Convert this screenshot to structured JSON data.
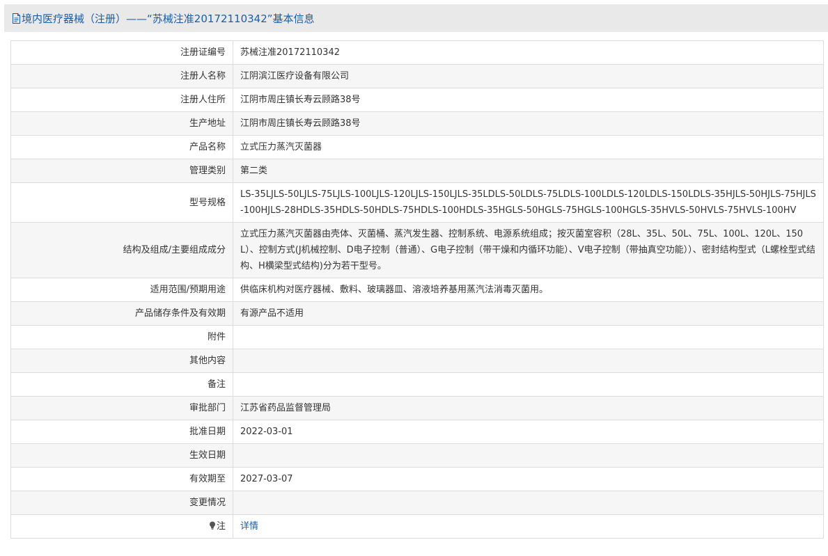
{
  "header": {
    "title": "境内医疗器械（注册）——“苏械注准20172110342”基本信息"
  },
  "rows": [
    {
      "label": "注册证编号",
      "value": "苏械注准20172110342"
    },
    {
      "label": "注册人名称",
      "value": "江阴滨江医疗设备有限公司"
    },
    {
      "label": "注册人住所",
      "value": "江阴市周庄镇长寿云顾路38号"
    },
    {
      "label": "生产地址",
      "value": "江阴市周庄镇长寿云顾路38号"
    },
    {
      "label": "产品名称",
      "value": "立式压力蒸汽灭菌器"
    },
    {
      "label": "管理类别",
      "value": "第二类"
    },
    {
      "label": "型号规格",
      "value": "LS-35LJLS-50LJLS-75LJLS-100LJLS-120LJLS-150LJLS-35LDLS-50LDLS-75LDLS-100LDLS-120LDLS-150LDLS-35HJLS-50HJLS-75HJLS-100HJLS-28HDLS-35HDLS-50HDLS-75HDLS-100HDLS-35HGLS-50HGLS-75HGLS-100HGLS-35HVLS-50HVLS-75HVLS-100HV"
    },
    {
      "label": "结构及组成/主要组成成分",
      "value": "立式压力蒸汽灭菌器由壳体、灭菌桶、蒸汽发生器、控制系统、电源系统组成；按灭菌室容积（28L、35L、50L、75L、100L、120L、150L）、控制方式(J机械控制、D电子控制（普通）、G电子控制（带干燥和内循环功能）、V电子控制（带抽真空功能））、密封结构型式（L螺栓型式结构、H横梁型式结构)分为若干型号。"
    },
    {
      "label": "适用范围/预期用途",
      "value": "供临床机构对医疗器械、敷料、玻璃器皿、溶液培养基用蒸汽法消毒灭菌用。"
    },
    {
      "label": "产品储存条件及有效期",
      "value": "有源产品不适用"
    },
    {
      "label": "附件",
      "value": ""
    },
    {
      "label": "其他内容",
      "value": ""
    },
    {
      "label": "备注",
      "value": ""
    },
    {
      "label": "审批部门",
      "value": "江苏省药品监督管理局"
    },
    {
      "label": "批准日期",
      "value": "2022-03-01"
    },
    {
      "label": "生效日期",
      "value": ""
    },
    {
      "label": "有效期至",
      "value": "2027-03-07"
    },
    {
      "label": "变更情况",
      "value": ""
    }
  ],
  "note_row": {
    "label": "注",
    "link_text": "详情",
    "icon": "bulb-icon"
  },
  "colors": {
    "header_bg": "#e9e9e9",
    "link": "#1a5ea8",
    "border": "#dcdcdc",
    "row_alt": "#f6f6f6"
  }
}
